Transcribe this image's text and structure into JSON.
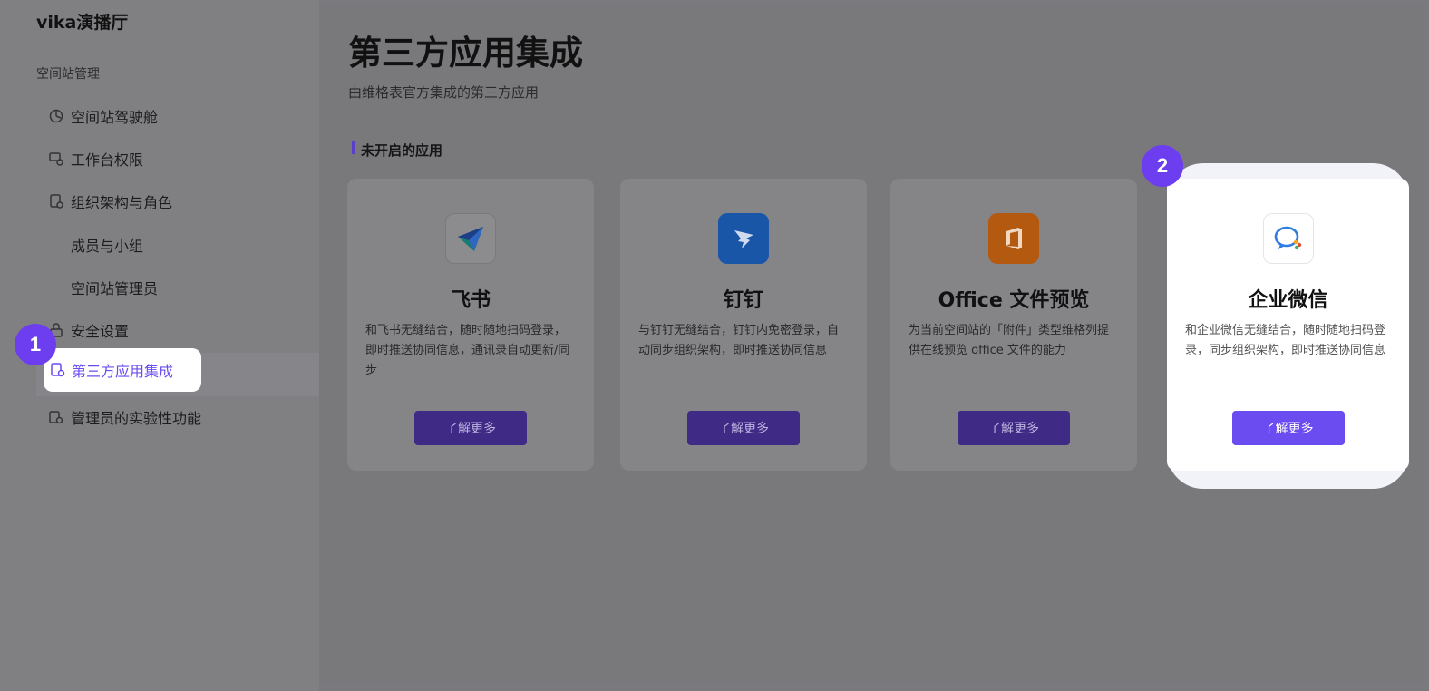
{
  "sidebar": {
    "brand": "vika演播厅",
    "section_label": "空间站管理",
    "items": [
      {
        "label": "空间站驾驶舱",
        "icon": "dashboard-icon"
      },
      {
        "label": "工作台权限",
        "icon": "workbench-icon"
      },
      {
        "label": "组织架构与角色",
        "icon": "org-icon"
      },
      {
        "label": "成员与小组"
      },
      {
        "label": "空间站管理员"
      },
      {
        "label": "安全设置",
        "icon": "lock-icon"
      },
      {
        "label": "第三方应用集成",
        "icon": "integration-icon",
        "active": true
      },
      {
        "label": "管理员的实验性功能",
        "icon": "lab-icon"
      }
    ]
  },
  "main": {
    "title": "第三方应用集成",
    "subtitle": "由维格表官方集成的第三方应用",
    "section_heading": "未开启的应用",
    "cards": [
      {
        "title": "飞书",
        "icon": "feishu-icon",
        "desc": "和飞书无缝结合，随时随地扫码登录，即时推送协同信息，通讯录自动更新/同步",
        "button": "了解更多"
      },
      {
        "title": "钉钉",
        "icon": "dingtalk-icon",
        "desc": "与钉钉无缝结合，钉钉内免密登录，自动同步组织架构，即时推送协同信息",
        "button": "了解更多"
      },
      {
        "title": "Office 文件预览",
        "icon": "office-icon",
        "desc": "为当前空间站的「附件」类型维格列提供在线预览 office 文件的能力",
        "button": "了解更多"
      },
      {
        "title": "企业微信",
        "icon": "wecom-icon",
        "desc": "和企业微信无缝结合，随时随地扫码登录，同步组织架构，即时推送协同信息",
        "button": "了解更多"
      }
    ]
  },
  "callouts": [
    "1",
    "2"
  ],
  "colors": {
    "accent": "#6b4cf0",
    "badge": "#6c3ef0"
  }
}
